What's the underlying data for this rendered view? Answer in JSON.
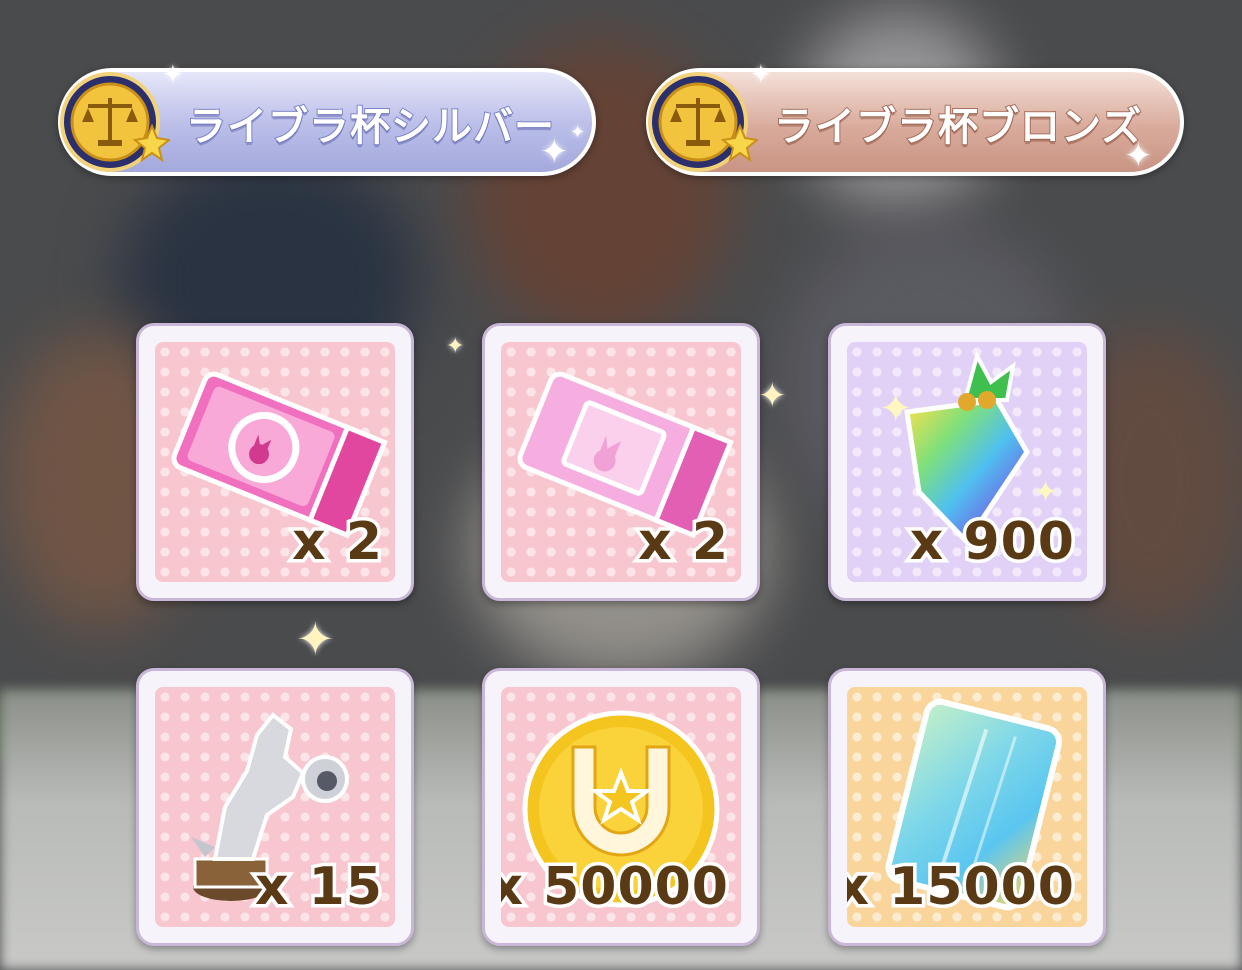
{
  "banners": [
    {
      "label": "ライブラ杯シルバー",
      "tier": "silver",
      "icon": "libra-cup-medal-icon"
    },
    {
      "label": "ライブラ杯ブロンズ",
      "tier": "bronze",
      "icon": "libra-cup-medal-icon"
    }
  ],
  "rewards": [
    {
      "item": "pink-gacha-ticket-icon",
      "quantity": "x 2"
    },
    {
      "item": "pink-support-ticket-icon",
      "quantity": "x 2"
    },
    {
      "item": "rainbow-carrot-jewel-icon",
      "quantity": "x 900"
    },
    {
      "item": "silver-horse-statue-icon",
      "quantity": "x 15"
    },
    {
      "item": "gold-horseshoe-coin-icon",
      "quantity": "x 50000"
    },
    {
      "item": "rainbow-card-icon",
      "quantity": "x 15000"
    }
  ],
  "colors": {
    "silver_banner": "#b9bde8",
    "bronze_banner": "#d9ab9c",
    "card_pink": "#f8c6cf",
    "card_purple": "#e2d1f7",
    "card_orange": "#f9d59c",
    "quantity_text": "#5a3a14"
  }
}
